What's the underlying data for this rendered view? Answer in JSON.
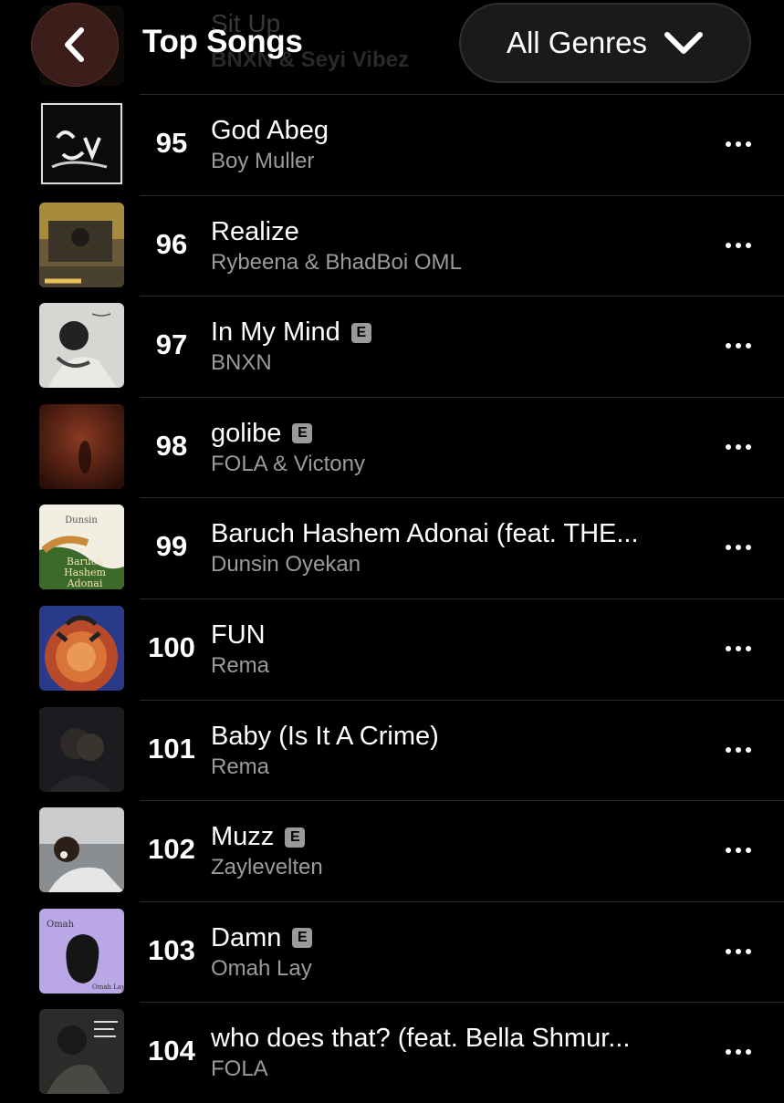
{
  "header": {
    "title": "Top Songs",
    "genre_button": "All Genres",
    "behind_row": {
      "title": "Sit Up",
      "artist": "BNXN & Seyi Vibez"
    }
  },
  "songs": [
    {
      "rank": "95",
      "title": "God Abeg",
      "artist": "Boy Muller",
      "explicit": false,
      "art": "god-abeg"
    },
    {
      "rank": "96",
      "title": "Realize",
      "artist": "Rybeena & BhadBoi OML",
      "explicit": false,
      "art": "realize"
    },
    {
      "rank": "97",
      "title": "In My Mind",
      "artist": "BNXN",
      "explicit": true,
      "art": "in-my-mind"
    },
    {
      "rank": "98",
      "title": "golibe",
      "artist": "FOLA & Victony",
      "explicit": true,
      "art": "golibe"
    },
    {
      "rank": "99",
      "title": "Baruch Hashem Adonai (feat. THE...",
      "artist": "Dunsin Oyekan",
      "explicit": false,
      "art": "baruch"
    },
    {
      "rank": "100",
      "title": "FUN",
      "artist": "Rema",
      "explicit": false,
      "art": "fun"
    },
    {
      "rank": "101",
      "title": "Baby (Is It A Crime)",
      "artist": "Rema",
      "explicit": false,
      "art": "baby"
    },
    {
      "rank": "102",
      "title": "Muzz",
      "artist": "Zaylevelten",
      "explicit": true,
      "art": "muzz"
    },
    {
      "rank": "103",
      "title": "Damn",
      "artist": "Omah Lay",
      "explicit": true,
      "art": "damn"
    },
    {
      "rank": "104",
      "title": "who does that? (feat. Bella Shmur...",
      "artist": "FOLA",
      "explicit": false,
      "art": "who-does-that"
    }
  ],
  "explicit_badge": "E",
  "colors": {
    "background": "#000000",
    "secondary_text": "#9b9b9b",
    "back_button": "#3b1d1a",
    "genre_button": "#1a1a1a"
  }
}
